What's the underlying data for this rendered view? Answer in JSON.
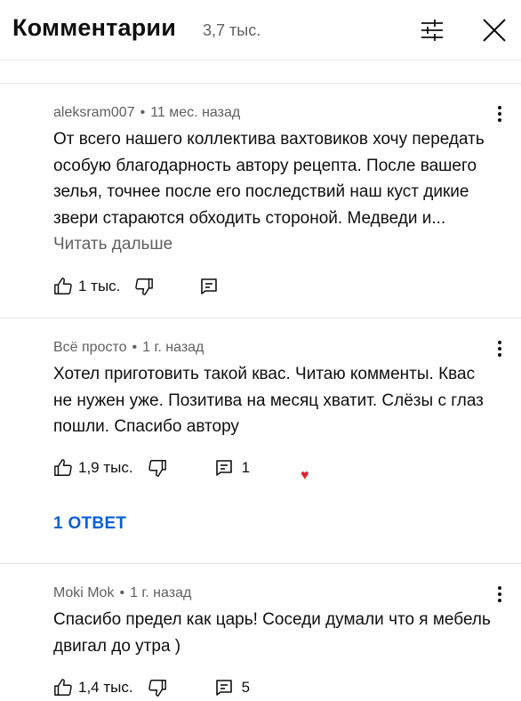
{
  "header": {
    "title": "Комментарии",
    "count": "3,7 тыс.",
    "filter_icon": "sliders-icon",
    "close_icon": "close-icon"
  },
  "comments": [
    {
      "author": "aleksram007",
      "time": "11 мес. назад",
      "text": "От всего нашего коллектива вахтовиков хочу передать особую благодарность автору рецепта. После вашего зелья, точнее после его последствий наш куст дикие звери стараются обходить стороной. Медведи и...",
      "read_more": "Читать дальше",
      "likes": "1 тыс.",
      "replies": ""
    },
    {
      "author": "Всё просто",
      "time": "1 г. назад",
      "text": "Хотел приготовить такой квас. Читаю комменты. Квас не нужен уже. Позитива на месяц хватит. Слёзы с глаз пошли. Спасибо автору",
      "likes": "1,9 тыс.",
      "replies": "1",
      "creator_heart": "♥",
      "reply_link": "1 ОТВЕТ"
    },
    {
      "author": "Moki Mok",
      "time": "1 г. назад",
      "text": "Спасибо предел как царь! Соседи думали что я мебель двигал до утра )",
      "likes": "1,4 тыс.",
      "replies": "5"
    }
  ],
  "separator": "•",
  "colors": {
    "text": "#0f0f0f",
    "secondary": "#606060",
    "link": "#065fd4",
    "heart": "#e0262f",
    "divider": "#e5e5e5"
  }
}
